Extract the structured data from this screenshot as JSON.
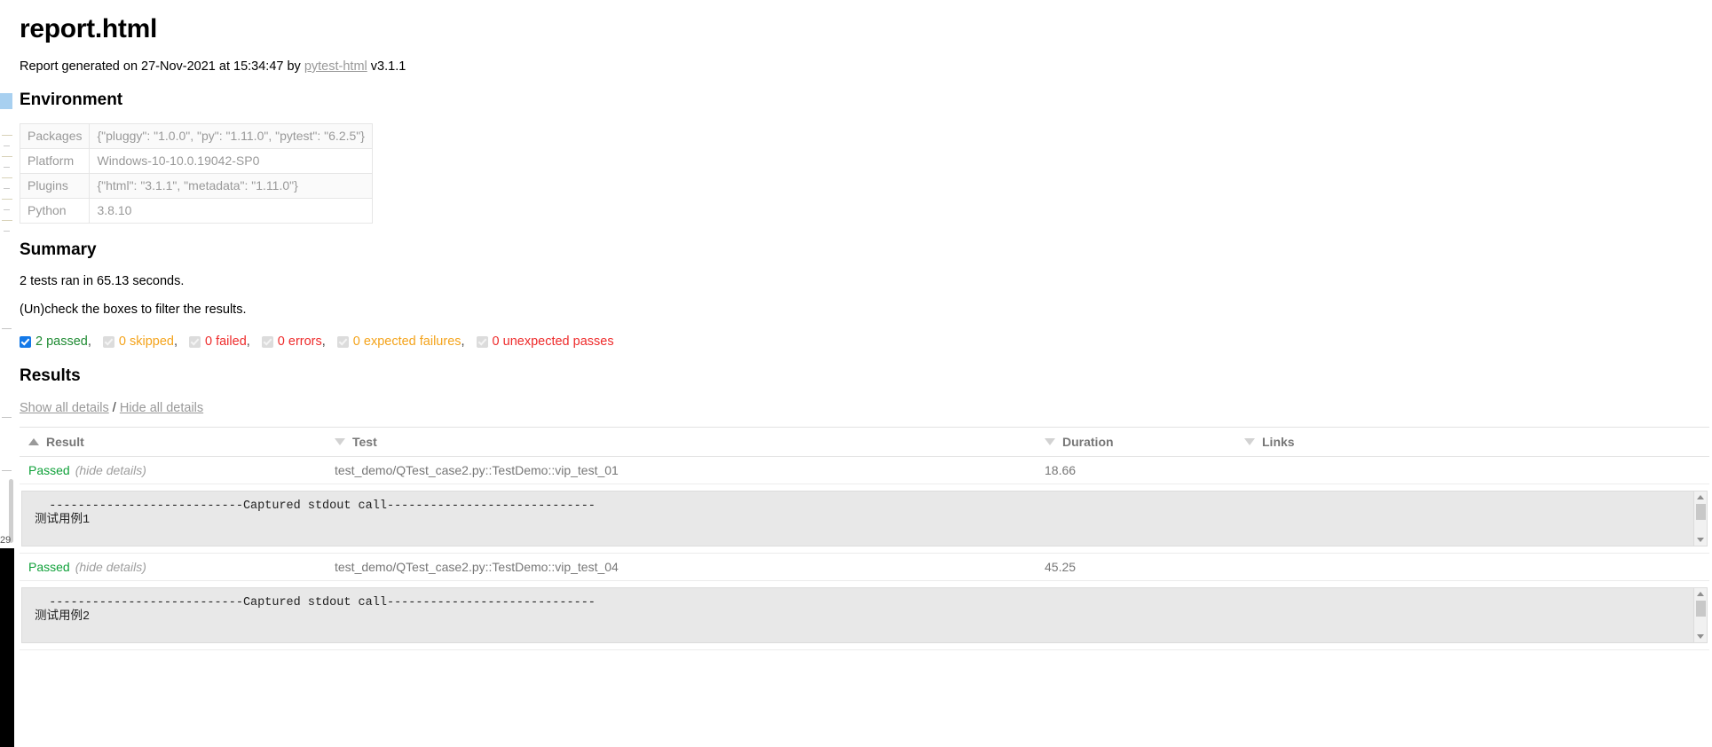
{
  "page": {
    "title": "report.html",
    "generated_prefix": "Report generated on 27-Nov-2021 at 15:34:47 by ",
    "generator_link": "pytest-html",
    "generator_version": " v3.1.1"
  },
  "environment": {
    "heading": "Environment",
    "rows": [
      {
        "key": "Packages",
        "value": "{\"pluggy\": \"1.0.0\", \"py\": \"1.11.0\", \"pytest\": \"6.2.5\"}"
      },
      {
        "key": "Platform",
        "value": "Windows-10-10.0.19042-SP0"
      },
      {
        "key": "Plugins",
        "value": "{\"html\": \"3.1.1\", \"metadata\": \"1.11.0\"}"
      },
      {
        "key": "Python",
        "value": "3.8.10"
      }
    ]
  },
  "summary": {
    "heading": "Summary",
    "run_line": "2 tests ran in 65.13 seconds.",
    "filter_hint": "(Un)check the boxes to filter the results.",
    "filters": [
      {
        "label": "2 passed",
        "checked": true,
        "color": "#1f8b33",
        "comma": ","
      },
      {
        "label": "0 skipped",
        "checked": false,
        "color": "#f4a31b",
        "comma": ","
      },
      {
        "label": "0 failed",
        "checked": false,
        "color": "#ee2b2b",
        "comma": ","
      },
      {
        "label": "0 errors",
        "checked": false,
        "color": "#ee2b2b",
        "comma": ","
      },
      {
        "label": "0 expected failures",
        "checked": false,
        "color": "#f4a31b",
        "comma": ","
      },
      {
        "label": "0 unexpected passes",
        "checked": false,
        "color": "#ee2b2b",
        "comma": ""
      }
    ]
  },
  "results": {
    "heading": "Results",
    "show_all": "Show all details",
    "separator": "/",
    "hide_all": "Hide all details",
    "columns": [
      {
        "label": "Result",
        "sort": "asc"
      },
      {
        "label": "Test",
        "sort": "desc"
      },
      {
        "label": "Duration",
        "sort": "desc"
      },
      {
        "label": "Links",
        "sort": "desc"
      }
    ],
    "rows": [
      {
        "result": "Passed",
        "toggle": "(hide details)",
        "test": "test_demo/QTest_case2.py::TestDemo::vip_test_01",
        "duration": "18.66",
        "links": "",
        "log": "  ---------------------------Captured stdout call-----------------------------\n测试用例1"
      },
      {
        "result": "Passed",
        "toggle": "(hide details)",
        "test": "test_demo/QTest_case2.py::TestDemo::vip_test_04",
        "duration": "45.25",
        "links": "",
        "log": "  ---------------------------Captured stdout call-----------------------------\n测试用例2"
      }
    ]
  },
  "gutter": {
    "line_number": "29"
  }
}
